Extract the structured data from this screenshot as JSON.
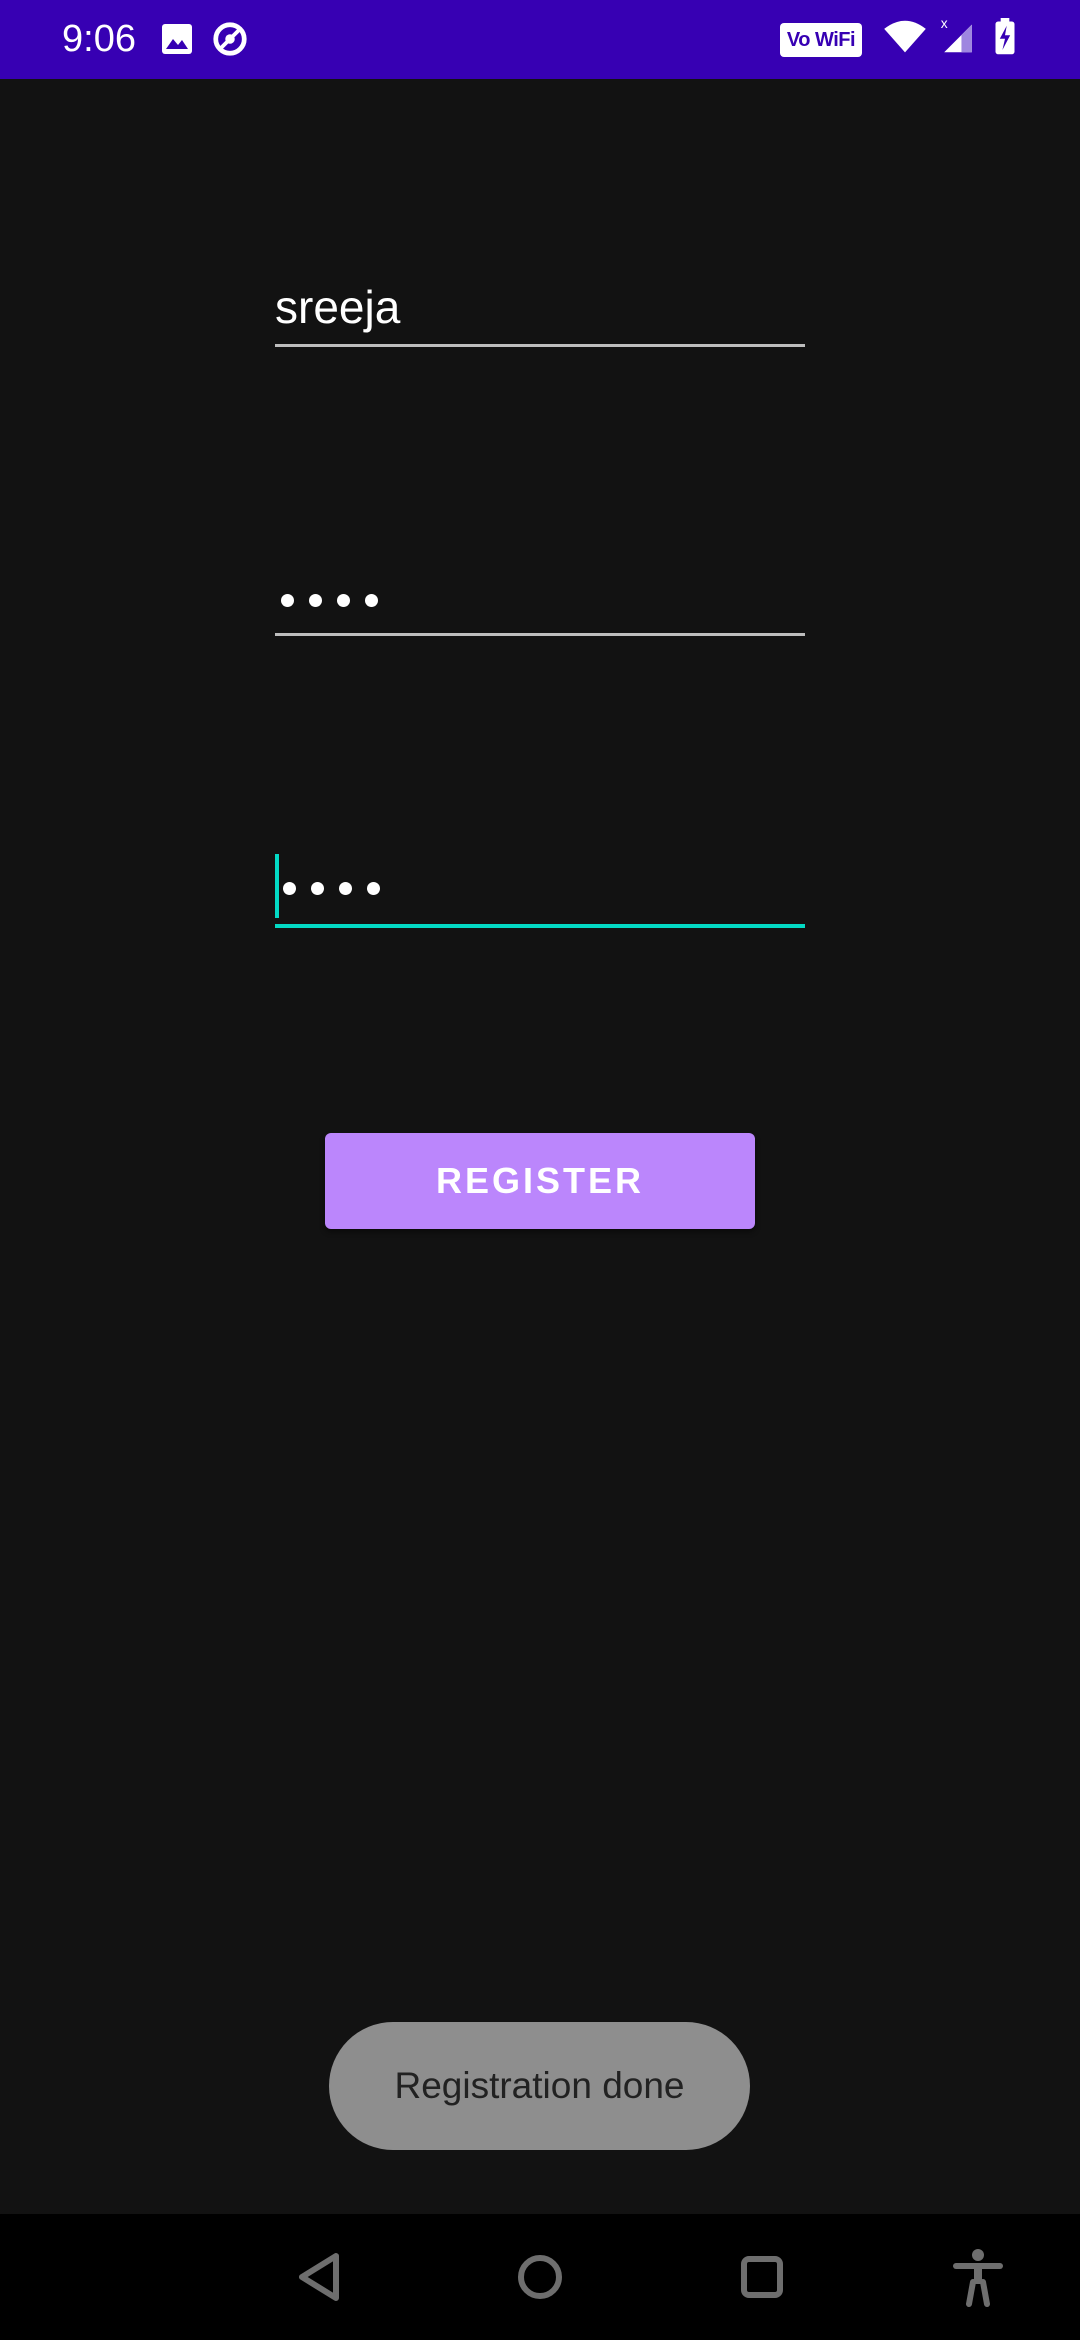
{
  "status_bar": {
    "time": "9:06",
    "vowifi_label": "Vo WiFi",
    "icons": [
      "image-icon",
      "sync-icon",
      "vowifi-icon",
      "wifi-icon",
      "signal-icon",
      "battery-charging-icon"
    ],
    "background_color": "#3700b3"
  },
  "form": {
    "username_value": "sreeja",
    "password_value": "••••",
    "confirm_password_value": "••••",
    "focused_field": "confirm_password",
    "accent_color": "#03dac5"
  },
  "register_button": {
    "label": "REGISTER",
    "color": "#bb86fc"
  },
  "toast": {
    "message": "Registration done"
  },
  "nav_bar": {
    "buttons": [
      "back-icon",
      "home-icon",
      "recents-icon",
      "accessibility-icon"
    ]
  }
}
